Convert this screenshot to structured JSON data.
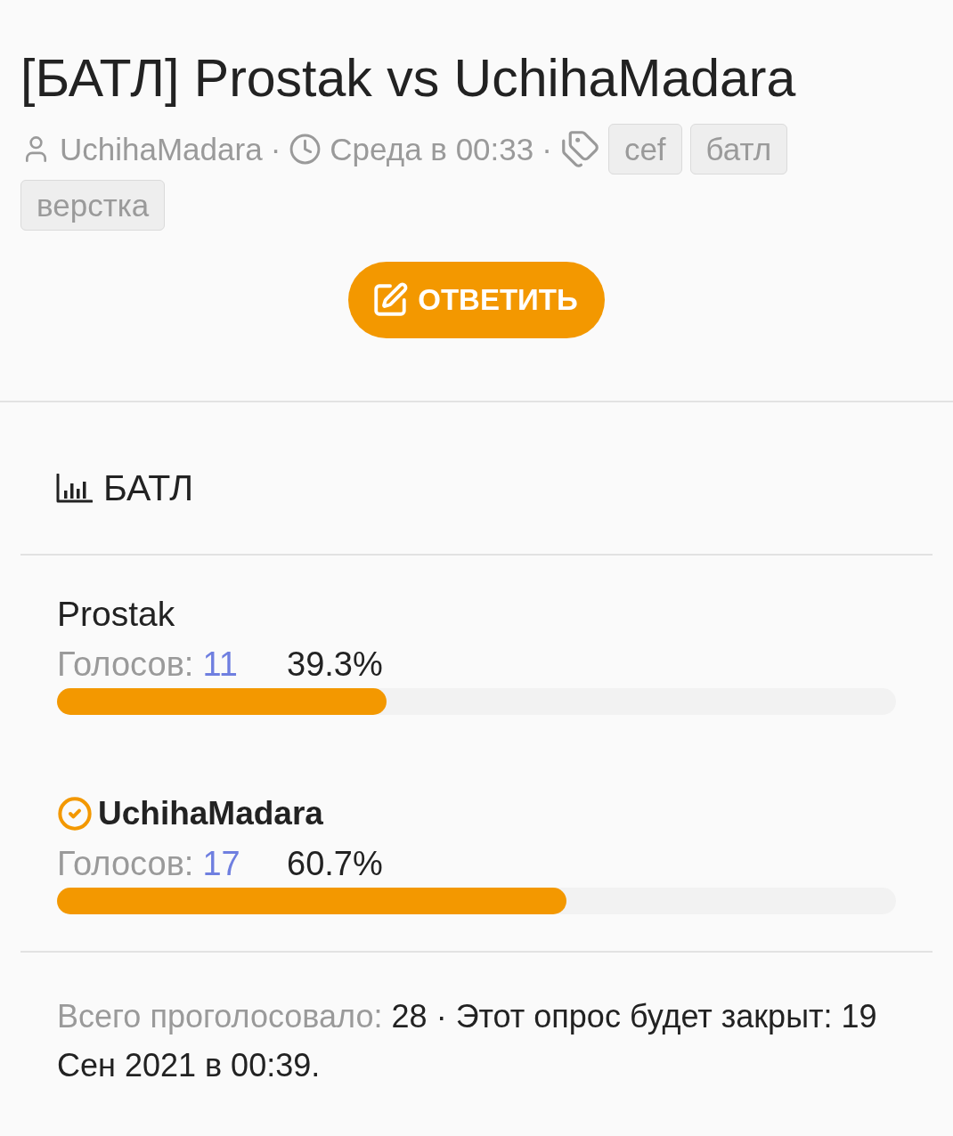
{
  "thread": {
    "title": "[БАТЛ] Prostak vs UchihaMadara",
    "author": "UchihaMadara",
    "separator_1": "·",
    "date": "Среда в 00:33",
    "separator_2": "·",
    "tags": [
      "cef",
      "батл",
      "верстка"
    ]
  },
  "reply_button": {
    "label": "ОТВЕТИТЬ"
  },
  "poll": {
    "title": "БАТЛ",
    "options": [
      {
        "name": "Prostak",
        "votes_label": "Голосов:",
        "votes": "11",
        "percent": "39.3%",
        "level": 0.393,
        "voted": false
      },
      {
        "name": "UchihaMadara",
        "votes_label": "Голосов:",
        "votes": "17",
        "percent": "60.7%",
        "level": 0.607,
        "voted": true
      }
    ],
    "footer": {
      "total_label": "Всего проголосовало:",
      "total": "28",
      "separator": "·",
      "closing": "Этот опрос будет закрыт: 19 Сен 2021 в 00:39."
    }
  }
}
